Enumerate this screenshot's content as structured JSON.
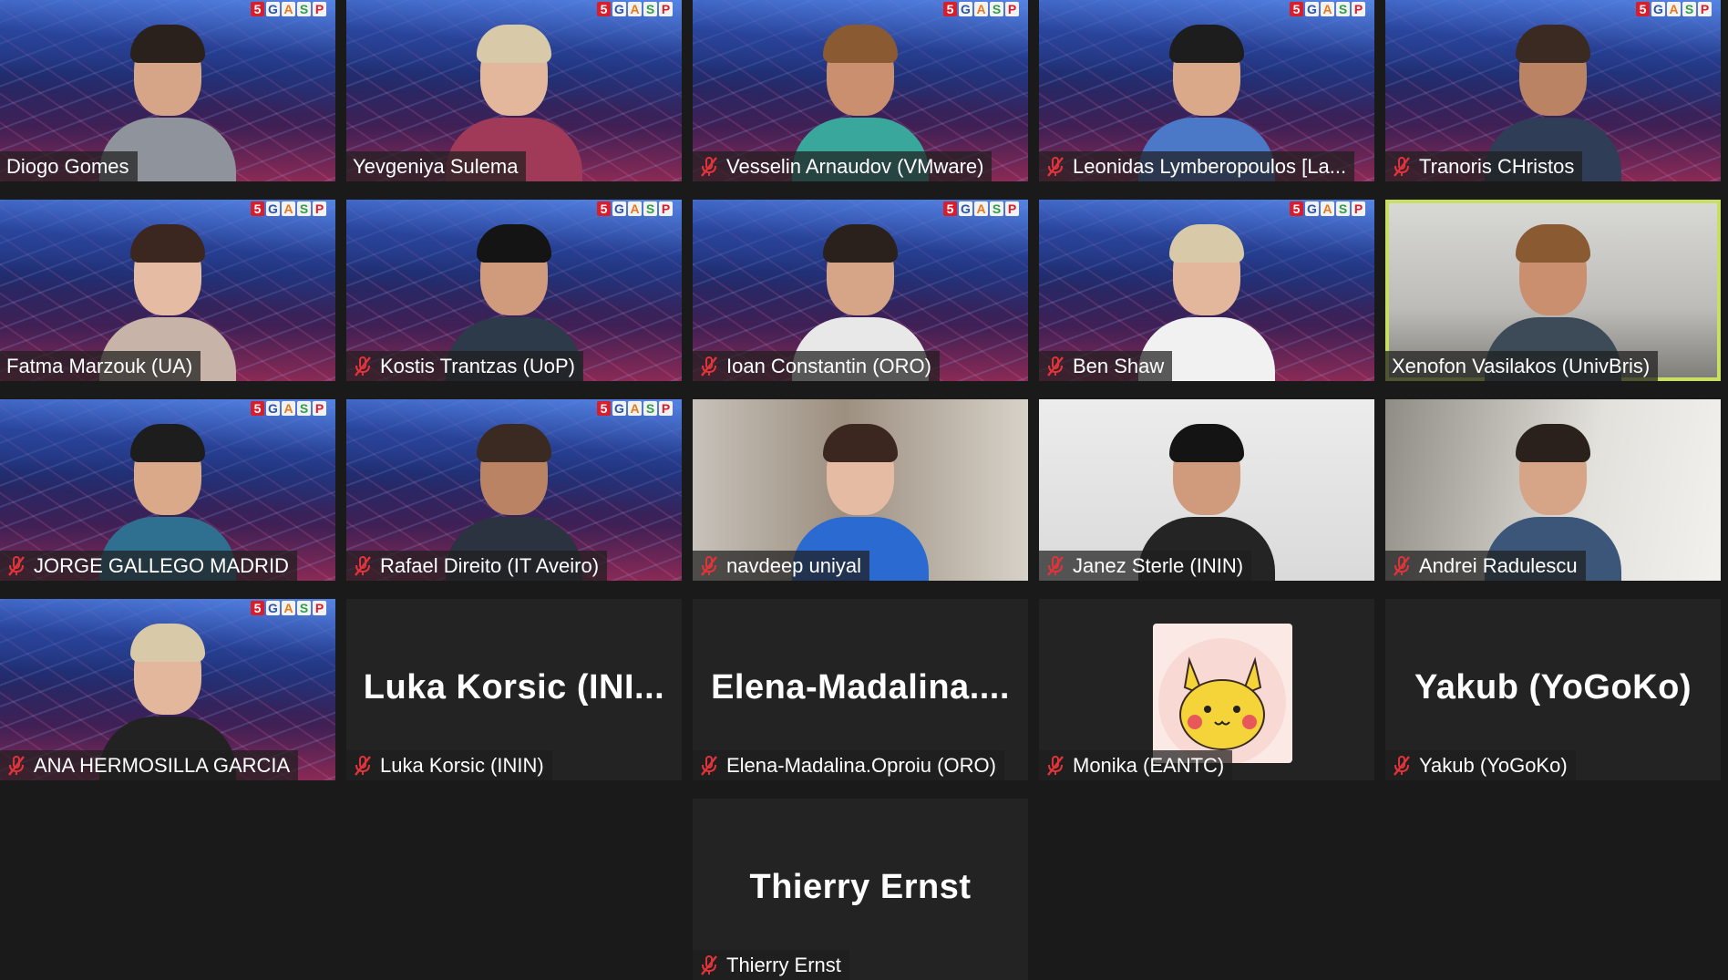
{
  "meeting": {
    "logo_letters": [
      "5",
      "G",
      "A",
      "S",
      "P"
    ],
    "participants": [
      {
        "name": "Diogo Gomes",
        "muted": false,
        "video": "on",
        "background": "5gasp"
      },
      {
        "name": "Yevgeniya Sulema",
        "muted": false,
        "video": "on",
        "background": "5gasp"
      },
      {
        "name": "Vesselin Arnaudov (VMware)",
        "muted": true,
        "video": "on",
        "background": "5gasp"
      },
      {
        "name": "Leonidas Lymberopoulos [La...",
        "muted": true,
        "video": "on",
        "background": "5gasp"
      },
      {
        "name": "Tranoris CHristos",
        "muted": true,
        "video": "on",
        "background": "5gasp"
      },
      {
        "name": "Fatma Marzouk (UA)",
        "muted": false,
        "video": "on",
        "background": "5gasp"
      },
      {
        "name": "Kostis Trantzas (UoP)",
        "muted": true,
        "video": "on",
        "background": "5gasp"
      },
      {
        "name": "Ioan Constantin (ORO)",
        "muted": true,
        "video": "on",
        "background": "5gasp"
      },
      {
        "name": "Ben Shaw",
        "muted": true,
        "video": "on",
        "background": "5gasp"
      },
      {
        "name": "Xenofon Vasilakos (UnivBris)",
        "muted": false,
        "video": "on",
        "background": "room",
        "active_speaker": true
      },
      {
        "name": "JORGE GALLEGO MADRID",
        "muted": true,
        "video": "on",
        "background": "5gasp"
      },
      {
        "name": "Rafael Direito (IT Aveiro)",
        "muted": true,
        "video": "on",
        "background": "5gasp"
      },
      {
        "name": "navdeep uniyal",
        "muted": true,
        "video": "on",
        "background": "blur"
      },
      {
        "name": "Janez Sterle (ININ)",
        "muted": true,
        "video": "on",
        "background": "white"
      },
      {
        "name": "Andrei Radulescu",
        "muted": true,
        "video": "on",
        "background": "office"
      },
      {
        "name": "ANA HERMOSILLA GARCIA",
        "muted": true,
        "video": "on",
        "background": "5gasp"
      },
      {
        "name": "Luka Korsic (ININ)",
        "muted": true,
        "video": "off",
        "display_name": "Luka  Korsic  (INI..."
      },
      {
        "name": "Elena-Madalina.Oproiu (ORO)",
        "muted": true,
        "video": "off",
        "display_name": "Elena-Madalina...."
      },
      {
        "name": "Monika (EANTC)",
        "muted": true,
        "video": "avatar",
        "avatar": "pikachu-avatar"
      },
      {
        "name": "Yakub (YoGoKo)",
        "muted": true,
        "video": "off",
        "display_name": "Yakub (YoGoKo)"
      },
      {
        "name": "Thierry Ernst",
        "muted": true,
        "video": "off",
        "display_name": "Thierry Ernst"
      }
    ]
  },
  "colors": {
    "background": "#1a1a1a",
    "tile_off": "#232323",
    "active_speaker_border": "#c7e063",
    "mute_red": "#e0343a"
  }
}
